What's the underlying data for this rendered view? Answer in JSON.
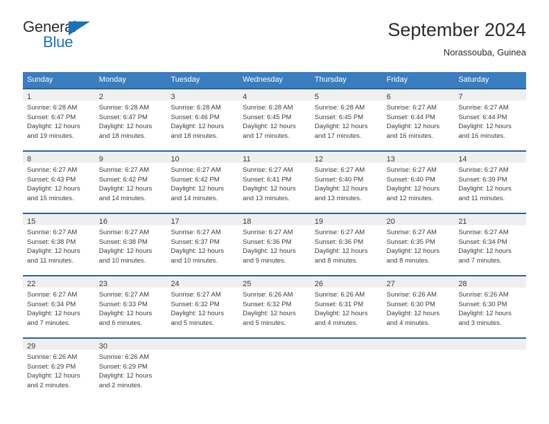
{
  "brand": {
    "name_top": "General",
    "name_bottom": "Blue",
    "accent_color": "#1a72b8"
  },
  "header": {
    "title": "September 2024",
    "subtitle": "Norassouba, Guinea"
  },
  "colors": {
    "header_row_background": "#3a7ebf",
    "header_row_text": "#ffffff",
    "cell_top_border": "#2a6099",
    "daynum_band": "#efefef",
    "body_text": "#3c3c3c",
    "page_background": "#ffffff"
  },
  "calendar": {
    "day_names": [
      "Sunday",
      "Monday",
      "Tuesday",
      "Wednesday",
      "Thursday",
      "Friday",
      "Saturday"
    ],
    "weeks": [
      [
        {
          "day": "1",
          "sunrise": "Sunrise: 6:28 AM",
          "sunset": "Sunset: 6:47 PM",
          "daylight1": "Daylight: 12 hours",
          "daylight2": "and 19 minutes."
        },
        {
          "day": "2",
          "sunrise": "Sunrise: 6:28 AM",
          "sunset": "Sunset: 6:47 PM",
          "daylight1": "Daylight: 12 hours",
          "daylight2": "and 18 minutes."
        },
        {
          "day": "3",
          "sunrise": "Sunrise: 6:28 AM",
          "sunset": "Sunset: 6:46 PM",
          "daylight1": "Daylight: 12 hours",
          "daylight2": "and 18 minutes."
        },
        {
          "day": "4",
          "sunrise": "Sunrise: 6:28 AM",
          "sunset": "Sunset: 6:45 PM",
          "daylight1": "Daylight: 12 hours",
          "daylight2": "and 17 minutes."
        },
        {
          "day": "5",
          "sunrise": "Sunrise: 6:28 AM",
          "sunset": "Sunset: 6:45 PM",
          "daylight1": "Daylight: 12 hours",
          "daylight2": "and 17 minutes."
        },
        {
          "day": "6",
          "sunrise": "Sunrise: 6:27 AM",
          "sunset": "Sunset: 6:44 PM",
          "daylight1": "Daylight: 12 hours",
          "daylight2": "and 16 minutes."
        },
        {
          "day": "7",
          "sunrise": "Sunrise: 6:27 AM",
          "sunset": "Sunset: 6:44 PM",
          "daylight1": "Daylight: 12 hours",
          "daylight2": "and 16 minutes."
        }
      ],
      [
        {
          "day": "8",
          "sunrise": "Sunrise: 6:27 AM",
          "sunset": "Sunset: 6:43 PM",
          "daylight1": "Daylight: 12 hours",
          "daylight2": "and 15 minutes."
        },
        {
          "day": "9",
          "sunrise": "Sunrise: 6:27 AM",
          "sunset": "Sunset: 6:42 PM",
          "daylight1": "Daylight: 12 hours",
          "daylight2": "and 14 minutes."
        },
        {
          "day": "10",
          "sunrise": "Sunrise: 6:27 AM",
          "sunset": "Sunset: 6:42 PM",
          "daylight1": "Daylight: 12 hours",
          "daylight2": "and 14 minutes."
        },
        {
          "day": "11",
          "sunrise": "Sunrise: 6:27 AM",
          "sunset": "Sunset: 6:41 PM",
          "daylight1": "Daylight: 12 hours",
          "daylight2": "and 13 minutes."
        },
        {
          "day": "12",
          "sunrise": "Sunrise: 6:27 AM",
          "sunset": "Sunset: 6:40 PM",
          "daylight1": "Daylight: 12 hours",
          "daylight2": "and 13 minutes."
        },
        {
          "day": "13",
          "sunrise": "Sunrise: 6:27 AM",
          "sunset": "Sunset: 6:40 PM",
          "daylight1": "Daylight: 12 hours",
          "daylight2": "and 12 minutes."
        },
        {
          "day": "14",
          "sunrise": "Sunrise: 6:27 AM",
          "sunset": "Sunset: 6:39 PM",
          "daylight1": "Daylight: 12 hours",
          "daylight2": "and 11 minutes."
        }
      ],
      [
        {
          "day": "15",
          "sunrise": "Sunrise: 6:27 AM",
          "sunset": "Sunset: 6:38 PM",
          "daylight1": "Daylight: 12 hours",
          "daylight2": "and 11 minutes."
        },
        {
          "day": "16",
          "sunrise": "Sunrise: 6:27 AM",
          "sunset": "Sunset: 6:38 PM",
          "daylight1": "Daylight: 12 hours",
          "daylight2": "and 10 minutes."
        },
        {
          "day": "17",
          "sunrise": "Sunrise: 6:27 AM",
          "sunset": "Sunset: 6:37 PM",
          "daylight1": "Daylight: 12 hours",
          "daylight2": "and 10 minutes."
        },
        {
          "day": "18",
          "sunrise": "Sunrise: 6:27 AM",
          "sunset": "Sunset: 6:36 PM",
          "daylight1": "Daylight: 12 hours",
          "daylight2": "and 9 minutes."
        },
        {
          "day": "19",
          "sunrise": "Sunrise: 6:27 AM",
          "sunset": "Sunset: 6:36 PM",
          "daylight1": "Daylight: 12 hours",
          "daylight2": "and 8 minutes."
        },
        {
          "day": "20",
          "sunrise": "Sunrise: 6:27 AM",
          "sunset": "Sunset: 6:35 PM",
          "daylight1": "Daylight: 12 hours",
          "daylight2": "and 8 minutes."
        },
        {
          "day": "21",
          "sunrise": "Sunrise: 6:27 AM",
          "sunset": "Sunset: 6:34 PM",
          "daylight1": "Daylight: 12 hours",
          "daylight2": "and 7 minutes."
        }
      ],
      [
        {
          "day": "22",
          "sunrise": "Sunrise: 6:27 AM",
          "sunset": "Sunset: 6:34 PM",
          "daylight1": "Daylight: 12 hours",
          "daylight2": "and 7 minutes."
        },
        {
          "day": "23",
          "sunrise": "Sunrise: 6:27 AM",
          "sunset": "Sunset: 6:33 PM",
          "daylight1": "Daylight: 12 hours",
          "daylight2": "and 6 minutes."
        },
        {
          "day": "24",
          "sunrise": "Sunrise: 6:27 AM",
          "sunset": "Sunset: 6:32 PM",
          "daylight1": "Daylight: 12 hours",
          "daylight2": "and 5 minutes."
        },
        {
          "day": "25",
          "sunrise": "Sunrise: 6:26 AM",
          "sunset": "Sunset: 6:32 PM",
          "daylight1": "Daylight: 12 hours",
          "daylight2": "and 5 minutes."
        },
        {
          "day": "26",
          "sunrise": "Sunrise: 6:26 AM",
          "sunset": "Sunset: 6:31 PM",
          "daylight1": "Daylight: 12 hours",
          "daylight2": "and 4 minutes."
        },
        {
          "day": "27",
          "sunrise": "Sunrise: 6:26 AM",
          "sunset": "Sunset: 6:30 PM",
          "daylight1": "Daylight: 12 hours",
          "daylight2": "and 4 minutes."
        },
        {
          "day": "28",
          "sunrise": "Sunrise: 6:26 AM",
          "sunset": "Sunset: 6:30 PM",
          "daylight1": "Daylight: 12 hours",
          "daylight2": "and 3 minutes."
        }
      ],
      [
        {
          "day": "29",
          "sunrise": "Sunrise: 6:26 AM",
          "sunset": "Sunset: 6:29 PM",
          "daylight1": "Daylight: 12 hours",
          "daylight2": "and 2 minutes."
        },
        {
          "day": "30",
          "sunrise": "Sunrise: 6:26 AM",
          "sunset": "Sunset: 6:29 PM",
          "daylight1": "Daylight: 12 hours",
          "daylight2": "and 2 minutes."
        },
        {
          "day": "",
          "sunrise": "",
          "sunset": "",
          "daylight1": "",
          "daylight2": ""
        },
        {
          "day": "",
          "sunrise": "",
          "sunset": "",
          "daylight1": "",
          "daylight2": ""
        },
        {
          "day": "",
          "sunrise": "",
          "sunset": "",
          "daylight1": "",
          "daylight2": ""
        },
        {
          "day": "",
          "sunrise": "",
          "sunset": "",
          "daylight1": "",
          "daylight2": ""
        },
        {
          "day": "",
          "sunrise": "",
          "sunset": "",
          "daylight1": "",
          "daylight2": ""
        }
      ]
    ]
  }
}
